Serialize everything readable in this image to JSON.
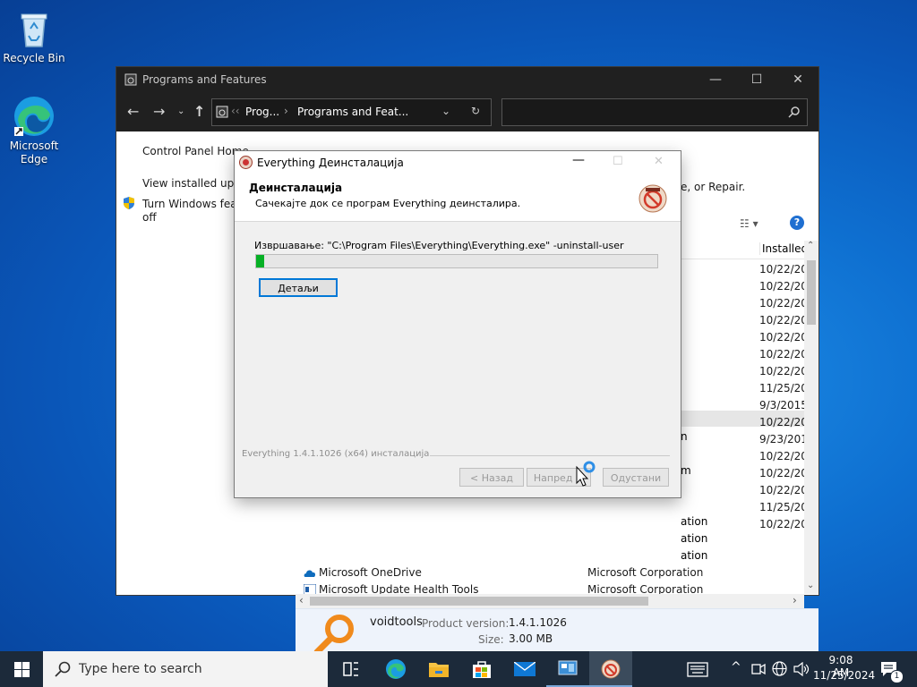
{
  "desktop": {
    "recycle_bin": "Recycle Bin",
    "edge": "Microsoft\nEdge"
  },
  "programs_window": {
    "title": "Programs and Features",
    "breadcrumb_1": "Prog...",
    "breadcrumb_2": "Programs and Feat...",
    "left": {
      "home": "Control Panel Home",
      "view_updates": "View installed updat",
      "turn_features": "Turn Windows featu",
      "turn_features_2": "off"
    },
    "partial_text": "e, or Repair.",
    "column_installed": "Installed (",
    "installed_dates": [
      "10/22/202",
      "10/22/202",
      "10/22/202",
      "10/22/202",
      "10/22/202",
      "10/22/202",
      "10/22/202",
      "11/25/202",
      "9/3/2015",
      "10/22/202",
      "9/23/2015",
      "10/22/202",
      "10/22/202",
      "10/22/202",
      "11/25/202",
      "10/22/202"
    ],
    "partial_pub": [
      "n",
      "m",
      "ation",
      "ation",
      "ation"
    ],
    "rows": [
      {
        "name": "Microsoft OneDrive",
        "publisher": "Microsoft Corporation"
      },
      {
        "name": "Microsoft Update Health Tools",
        "publisher": "Microsoft Corporation"
      }
    ],
    "details": {
      "publisher": "voidtools",
      "version_label": "Product version:",
      "version": "1.4.1.1026",
      "size_label": "Size:",
      "size": "3.00 MB"
    }
  },
  "dialog": {
    "title": "Everything Деинсталација",
    "header_title": "Деинсталација",
    "header_sub": "Сачекајте док се програм Everything деинсталира.",
    "status": "Извршавање: \"C:\\Program Files\\Everything\\Everything.exe\" -uninstall-user",
    "progress": 0.02,
    "details_btn": "Детаљи",
    "footer_brand": "Everything 1.4.1.1026 (x64) инсталација",
    "back_btn": "< Назад",
    "next_btn": "Напред >",
    "cancel_btn": "Одустани"
  },
  "taskbar": {
    "search_placeholder": "Type here to search",
    "time": "9:08 AM",
    "date": "11/25/2024",
    "notif_count": "1"
  },
  "colors": {
    "accent": "#0078d7",
    "progress": "#06b025"
  }
}
